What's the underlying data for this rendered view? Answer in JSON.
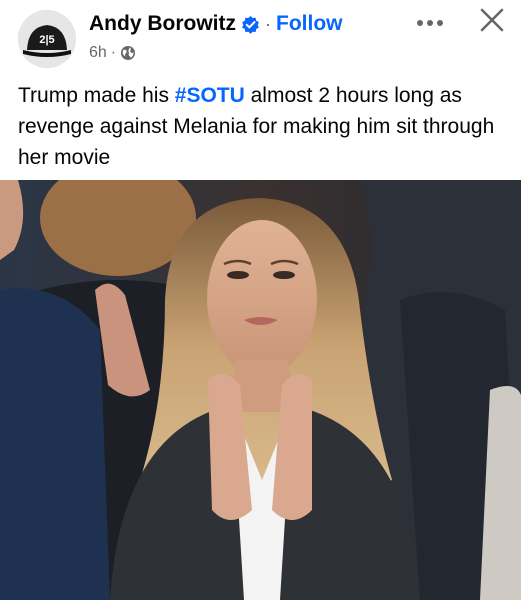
{
  "post": {
    "author": "Andy Borowitz",
    "follow_label": "Follow",
    "separator": "·",
    "time": "6h",
    "audience_icon": "globe-icon",
    "verified_icon": "verified-badge-icon",
    "avatar_text": "2|5",
    "text_before": "Trump made his ",
    "hashtag": "#SOTU",
    "text_after": " almost 2 hours long as revenge against Melania for making him sit through her movie"
  },
  "colors": {
    "link": "#0866ff",
    "secondary": "#65676b",
    "text": "#050505"
  }
}
